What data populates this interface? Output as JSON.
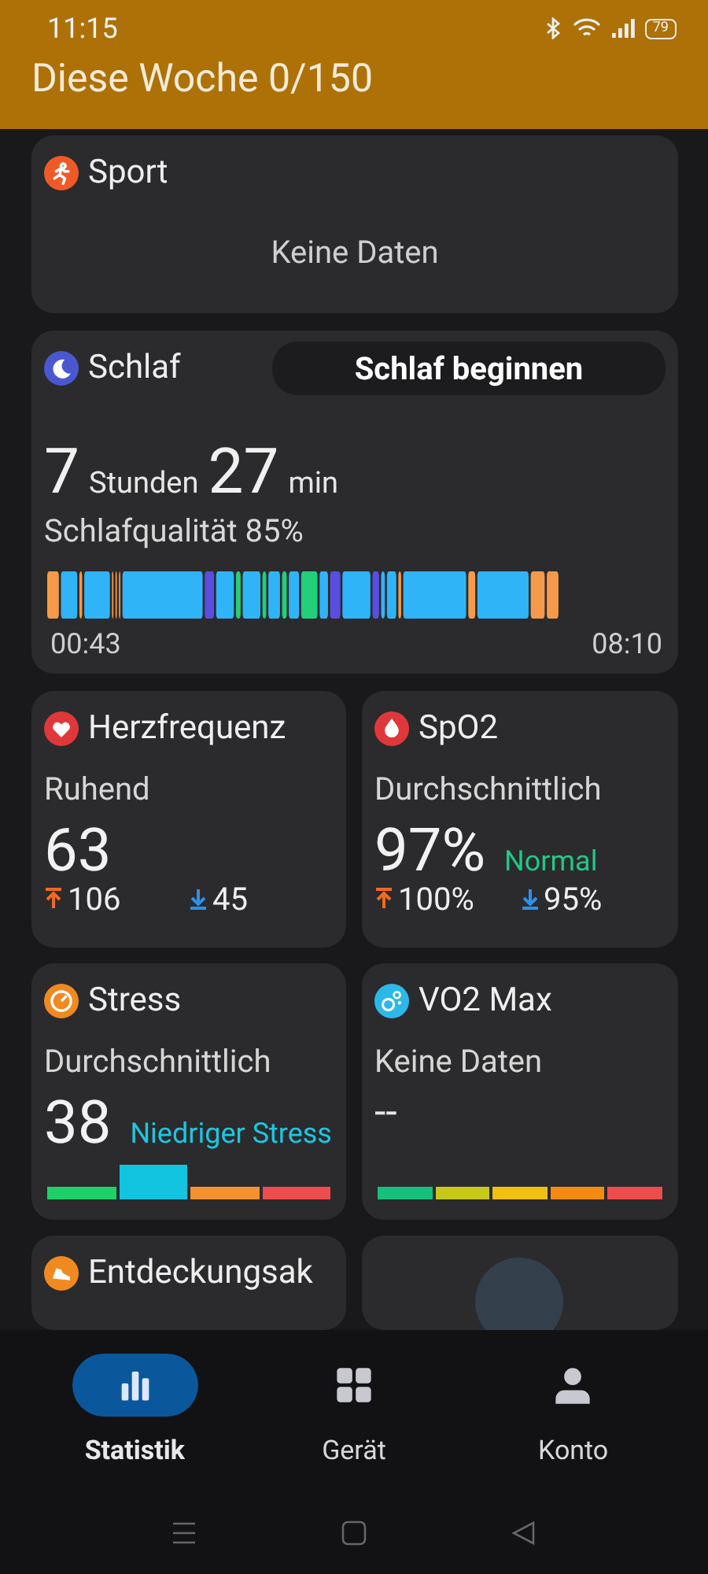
{
  "status_bar": {
    "time": "11:15",
    "battery": "79"
  },
  "header": {
    "title": "Diese Woche 0/150"
  },
  "sport": {
    "title": "Sport",
    "empty": "Keine Daten"
  },
  "sleep": {
    "title": "Schlaf",
    "button": "Schlaf beginnen",
    "hours": "7",
    "hours_unit": "Stunden",
    "minutes": "27",
    "minutes_unit": "min",
    "quality": "Schlafqualität 85%",
    "start": "00:43",
    "end": "08:10"
  },
  "heart_rate": {
    "title": "Herzfrequenz",
    "label": "Ruhend",
    "value": "63",
    "max": "106",
    "min": "45"
  },
  "spo2": {
    "title": "SpO2",
    "label": "Durchschnittlich",
    "value": "97%",
    "status": "Normal",
    "max": "100%",
    "min": "95%"
  },
  "stress": {
    "title": "Stress",
    "label": "Durchschnittlich",
    "value": "38",
    "status": "Niedriger Stress",
    "scale": [
      {
        "color": "#1ed06a",
        "selected": false
      },
      {
        "color": "#12c4e0",
        "selected": true
      },
      {
        "color": "#f5912e",
        "selected": false
      },
      {
        "color": "#ee4d4d",
        "selected": false
      }
    ]
  },
  "vo2max": {
    "title": "VO2 Max",
    "label": "Keine Daten",
    "value": "--",
    "scale": [
      {
        "color": "#14c07a"
      },
      {
        "color": "#c8c818"
      },
      {
        "color": "#f0c010"
      },
      {
        "color": "#f58a10"
      },
      {
        "color": "#ee4d4d"
      }
    ]
  },
  "exploration": {
    "title": "Entdeckungsak"
  },
  "tabs": [
    {
      "label": "Statistik",
      "selected": true,
      "kind": "chart"
    },
    {
      "label": "Gerät",
      "selected": false,
      "kind": "grid"
    },
    {
      "label": "Konto",
      "selected": false,
      "kind": "person"
    }
  ]
}
